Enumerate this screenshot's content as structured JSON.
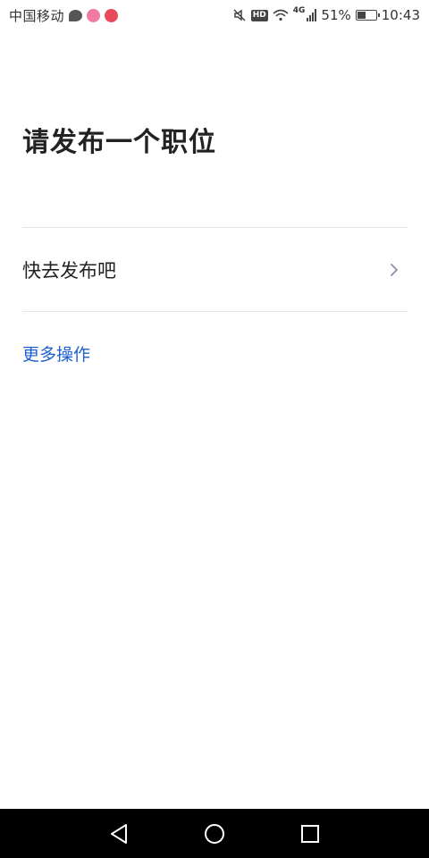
{
  "status_bar": {
    "carrier": "中国移动",
    "hd_label": "HD",
    "network_label": "4G",
    "battery_percent": "51%",
    "battery_level": 0.51,
    "time": "10:43",
    "icons": [
      "chat-icon",
      "pink-app-icon",
      "red-app-icon",
      "mute-icon",
      "wifi-icon",
      "signal-icon",
      "battery-icon"
    ]
  },
  "main": {
    "title": "请发布一个职位",
    "publish_row_label": "快去发布吧",
    "more_actions_label": "更多操作"
  },
  "colors": {
    "accent": "#1c5fd2",
    "divider": "#e6e6e6",
    "chevron": "#8a8fa8"
  },
  "nav_bar": {
    "icons": [
      "back-icon",
      "home-icon",
      "recent-apps-icon"
    ]
  }
}
